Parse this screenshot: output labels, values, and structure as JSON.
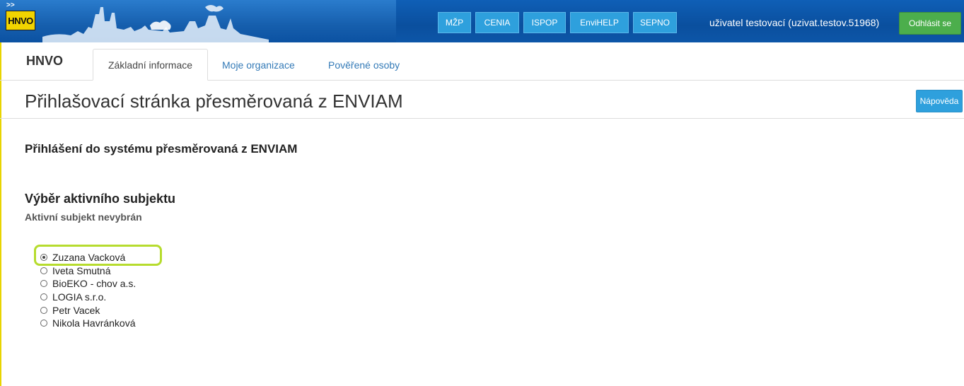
{
  "header": {
    "logo_text": "HNVO",
    "logo_arrow": ">>",
    "buttons": [
      {
        "label": "MŽP"
      },
      {
        "label": "CENIA"
      },
      {
        "label": "ISPOP"
      },
      {
        "label": "EnviHELP"
      },
      {
        "label": "SEPNO"
      }
    ],
    "user": "uživatel testovací (uzivat.testov.51968)",
    "logout_label": "Odhlásit se",
    "colors": {
      "banner": "#0a4f9e",
      "button": "#2ea0dd",
      "logout": "#4cae4c",
      "logo": "#f2d400"
    }
  },
  "nav": {
    "brand": "HNVO",
    "tabs": [
      {
        "label": "Základní informace",
        "active": true
      },
      {
        "label": "Moje organizace",
        "active": false
      },
      {
        "label": "Pověřené osoby",
        "active": false
      }
    ]
  },
  "page": {
    "title": "Přihlašovací stránka přesměrovaná z ENVIAM",
    "help_label": "Nápověda",
    "section_title": "Přihlášení do systému přesměrovaná z ENVIAM",
    "subject_title": "Výběr aktivního subjektu",
    "subject_status": "Aktivní subjekt nevybrán",
    "subjects": [
      {
        "label": "Zuzana Vacková",
        "selected": true
      },
      {
        "label": "Iveta Smutná",
        "selected": false
      },
      {
        "label": "BioEKO - chov a.s.",
        "selected": false
      },
      {
        "label": "LOGIA s.r.o.",
        "selected": false
      },
      {
        "label": "Petr Vacek",
        "selected": false
      },
      {
        "label": "Nikola Havránková",
        "selected": false
      }
    ],
    "highlight_color": "#b6dc2e"
  }
}
